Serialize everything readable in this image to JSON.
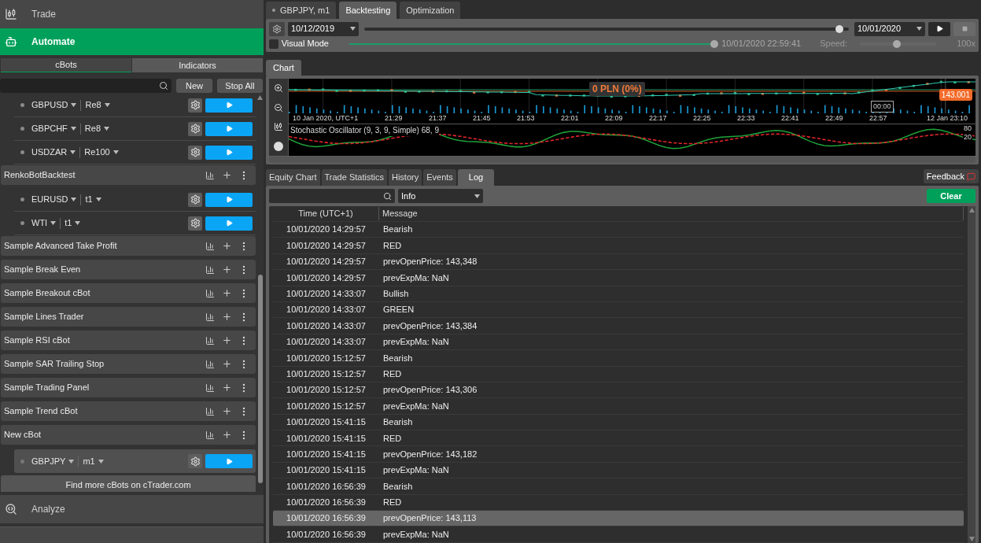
{
  "top_nav": [
    {
      "kind": "trade",
      "label": "Trade",
      "selected": false
    },
    {
      "kind": "automate",
      "label": "Automate",
      "selected": true
    }
  ],
  "subtabs": [
    {
      "label": "cBots",
      "selected": true
    },
    {
      "label": "Indicators",
      "selected": false
    }
  ],
  "toolbar_buttons": [
    "New",
    "Stop All"
  ],
  "bots": [
    {
      "kind": "instance",
      "symbol": "GBPUSD",
      "timeframe": "Re8",
      "selected": false
    },
    {
      "kind": "instance",
      "symbol": "GBPCHF",
      "timeframe": "Re8",
      "selected": false
    },
    {
      "kind": "instance",
      "symbol": "USDZAR",
      "timeframe": "Re100",
      "selected": false
    },
    {
      "kind": "bot",
      "name": "RenkoBotBacktest",
      "children": [
        {
          "kind": "instance",
          "symbol": "EURUSD",
          "timeframe": "t1",
          "selected": false
        },
        {
          "kind": "instance",
          "symbol": "WTI",
          "timeframe": "t1",
          "selected": false
        }
      ]
    },
    {
      "kind": "bot",
      "name": "Sample Advanced Take Profit"
    },
    {
      "kind": "bot",
      "name": "Sample Break Even"
    },
    {
      "kind": "bot",
      "name": "Sample Breakout cBot"
    },
    {
      "kind": "bot",
      "name": "Sample Lines Trader"
    },
    {
      "kind": "bot",
      "name": "Sample RSI cBot"
    },
    {
      "kind": "bot",
      "name": "Sample SAR Trailing Stop"
    },
    {
      "kind": "bot",
      "name": "Sample Trading Panel"
    },
    {
      "kind": "bot",
      "name": "Sample Trend cBot"
    },
    {
      "kind": "bot",
      "name": "New cBot",
      "children": [
        {
          "kind": "instance",
          "symbol": "GBPJPY",
          "timeframe": "m1",
          "selected": true
        }
      ]
    }
  ],
  "find_more": "Find more cBots on cTrader.com",
  "bottom_nav": [
    {
      "kind": "analyze",
      "label": "Analyze",
      "selected": false
    }
  ],
  "doc_tabs": [
    {
      "label": "GBPJPY, m1",
      "selected": false,
      "kind": "instance"
    },
    {
      "label": "Backtesting",
      "selected": true,
      "kind": "plain"
    },
    {
      "label": "Optimization",
      "selected": false,
      "kind": "plain"
    }
  ],
  "backtest": {
    "start_date": "10/12/2019",
    "end_date": "10/01/2020",
    "range": {
      "level": 0.98
    },
    "visual_mode": {
      "label": "Visual Mode",
      "checked": false
    },
    "progress": {
      "level": 1
    },
    "current_time": "10/01/2020 22:59:41",
    "speed_label": "Speed:",
    "speed": {
      "level": 0.48
    },
    "speed_value": "100x"
  },
  "chart_tab": {
    "label": "Chart",
    "selected": true
  },
  "chart": {
    "pnl": "0 PLN (0%)",
    "price": "143.001",
    "cursor_time": "00:00",
    "time_labels": [
      "10 Jan 2020, UTC+1",
      "21:29",
      "21:37",
      "21:45",
      "21:53",
      "22:01",
      "22:09",
      "22:17",
      "22:25",
      "22:33",
      "22:41",
      "22:49",
      "22:57",
      "12 Jan 23:10"
    ],
    "indicator": "Stochastic Oscillator (9, 3, 9, Simple) 68, 9",
    "indicator_ticks": [
      "80",
      "20"
    ]
  },
  "result_tabs": [
    {
      "label": "Equity Chart",
      "selected": false
    },
    {
      "label": "Trade Statistics",
      "selected": false
    },
    {
      "label": "History",
      "selected": false
    },
    {
      "label": "Events",
      "selected": false
    },
    {
      "label": "Log",
      "selected": true
    }
  ],
  "feedback": "Feedback",
  "log": {
    "filter": "Info",
    "clear": "Clear",
    "columns": [
      "Time (UTC+1)",
      "Message"
    ],
    "rows": [
      {
        "time": "10/01/2020 14:29:57",
        "message": "Bearish",
        "selected": false
      },
      {
        "time": "10/01/2020 14:29:57",
        "message": "RED",
        "selected": false
      },
      {
        "time": "10/01/2020 14:29:57",
        "message": "prevOpenPrice: 143,348",
        "selected": false
      },
      {
        "time": "10/01/2020 14:29:57",
        "message": "prevExpMa: NaN",
        "selected": false
      },
      {
        "time": "10/01/2020 14:33:07",
        "message": "Bullish",
        "selected": false
      },
      {
        "time": "10/01/2020 14:33:07",
        "message": "GREEN",
        "selected": false
      },
      {
        "time": "10/01/2020 14:33:07",
        "message": "prevOpenPrice: 143,384",
        "selected": false
      },
      {
        "time": "10/01/2020 14:33:07",
        "message": "prevExpMa: NaN",
        "selected": false
      },
      {
        "time": "10/01/2020 15:12:57",
        "message": "Bearish",
        "selected": false
      },
      {
        "time": "10/01/2020 15:12:57",
        "message": "RED",
        "selected": false
      },
      {
        "time": "10/01/2020 15:12:57",
        "message": "prevOpenPrice: 143,306",
        "selected": false
      },
      {
        "time": "10/01/2020 15:12:57",
        "message": "prevExpMa: NaN",
        "selected": false
      },
      {
        "time": "10/01/2020 15:41:15",
        "message": "Bearish",
        "selected": false
      },
      {
        "time": "10/01/2020 15:41:15",
        "message": "RED",
        "selected": false
      },
      {
        "time": "10/01/2020 15:41:15",
        "message": "prevOpenPrice: 143,182",
        "selected": false
      },
      {
        "time": "10/01/2020 15:41:15",
        "message": "prevExpMa: NaN",
        "selected": false
      },
      {
        "time": "10/01/2020 16:56:39",
        "message": "Bearish",
        "selected": false
      },
      {
        "time": "10/01/2020 16:56:39",
        "message": "RED",
        "selected": false
      },
      {
        "time": "10/01/2020 16:56:39",
        "message": "prevOpenPrice: 143,113",
        "selected": true
      },
      {
        "time": "10/01/2020 16:56:39",
        "message": "prevExpMa: NaN",
        "selected": false
      }
    ]
  }
}
